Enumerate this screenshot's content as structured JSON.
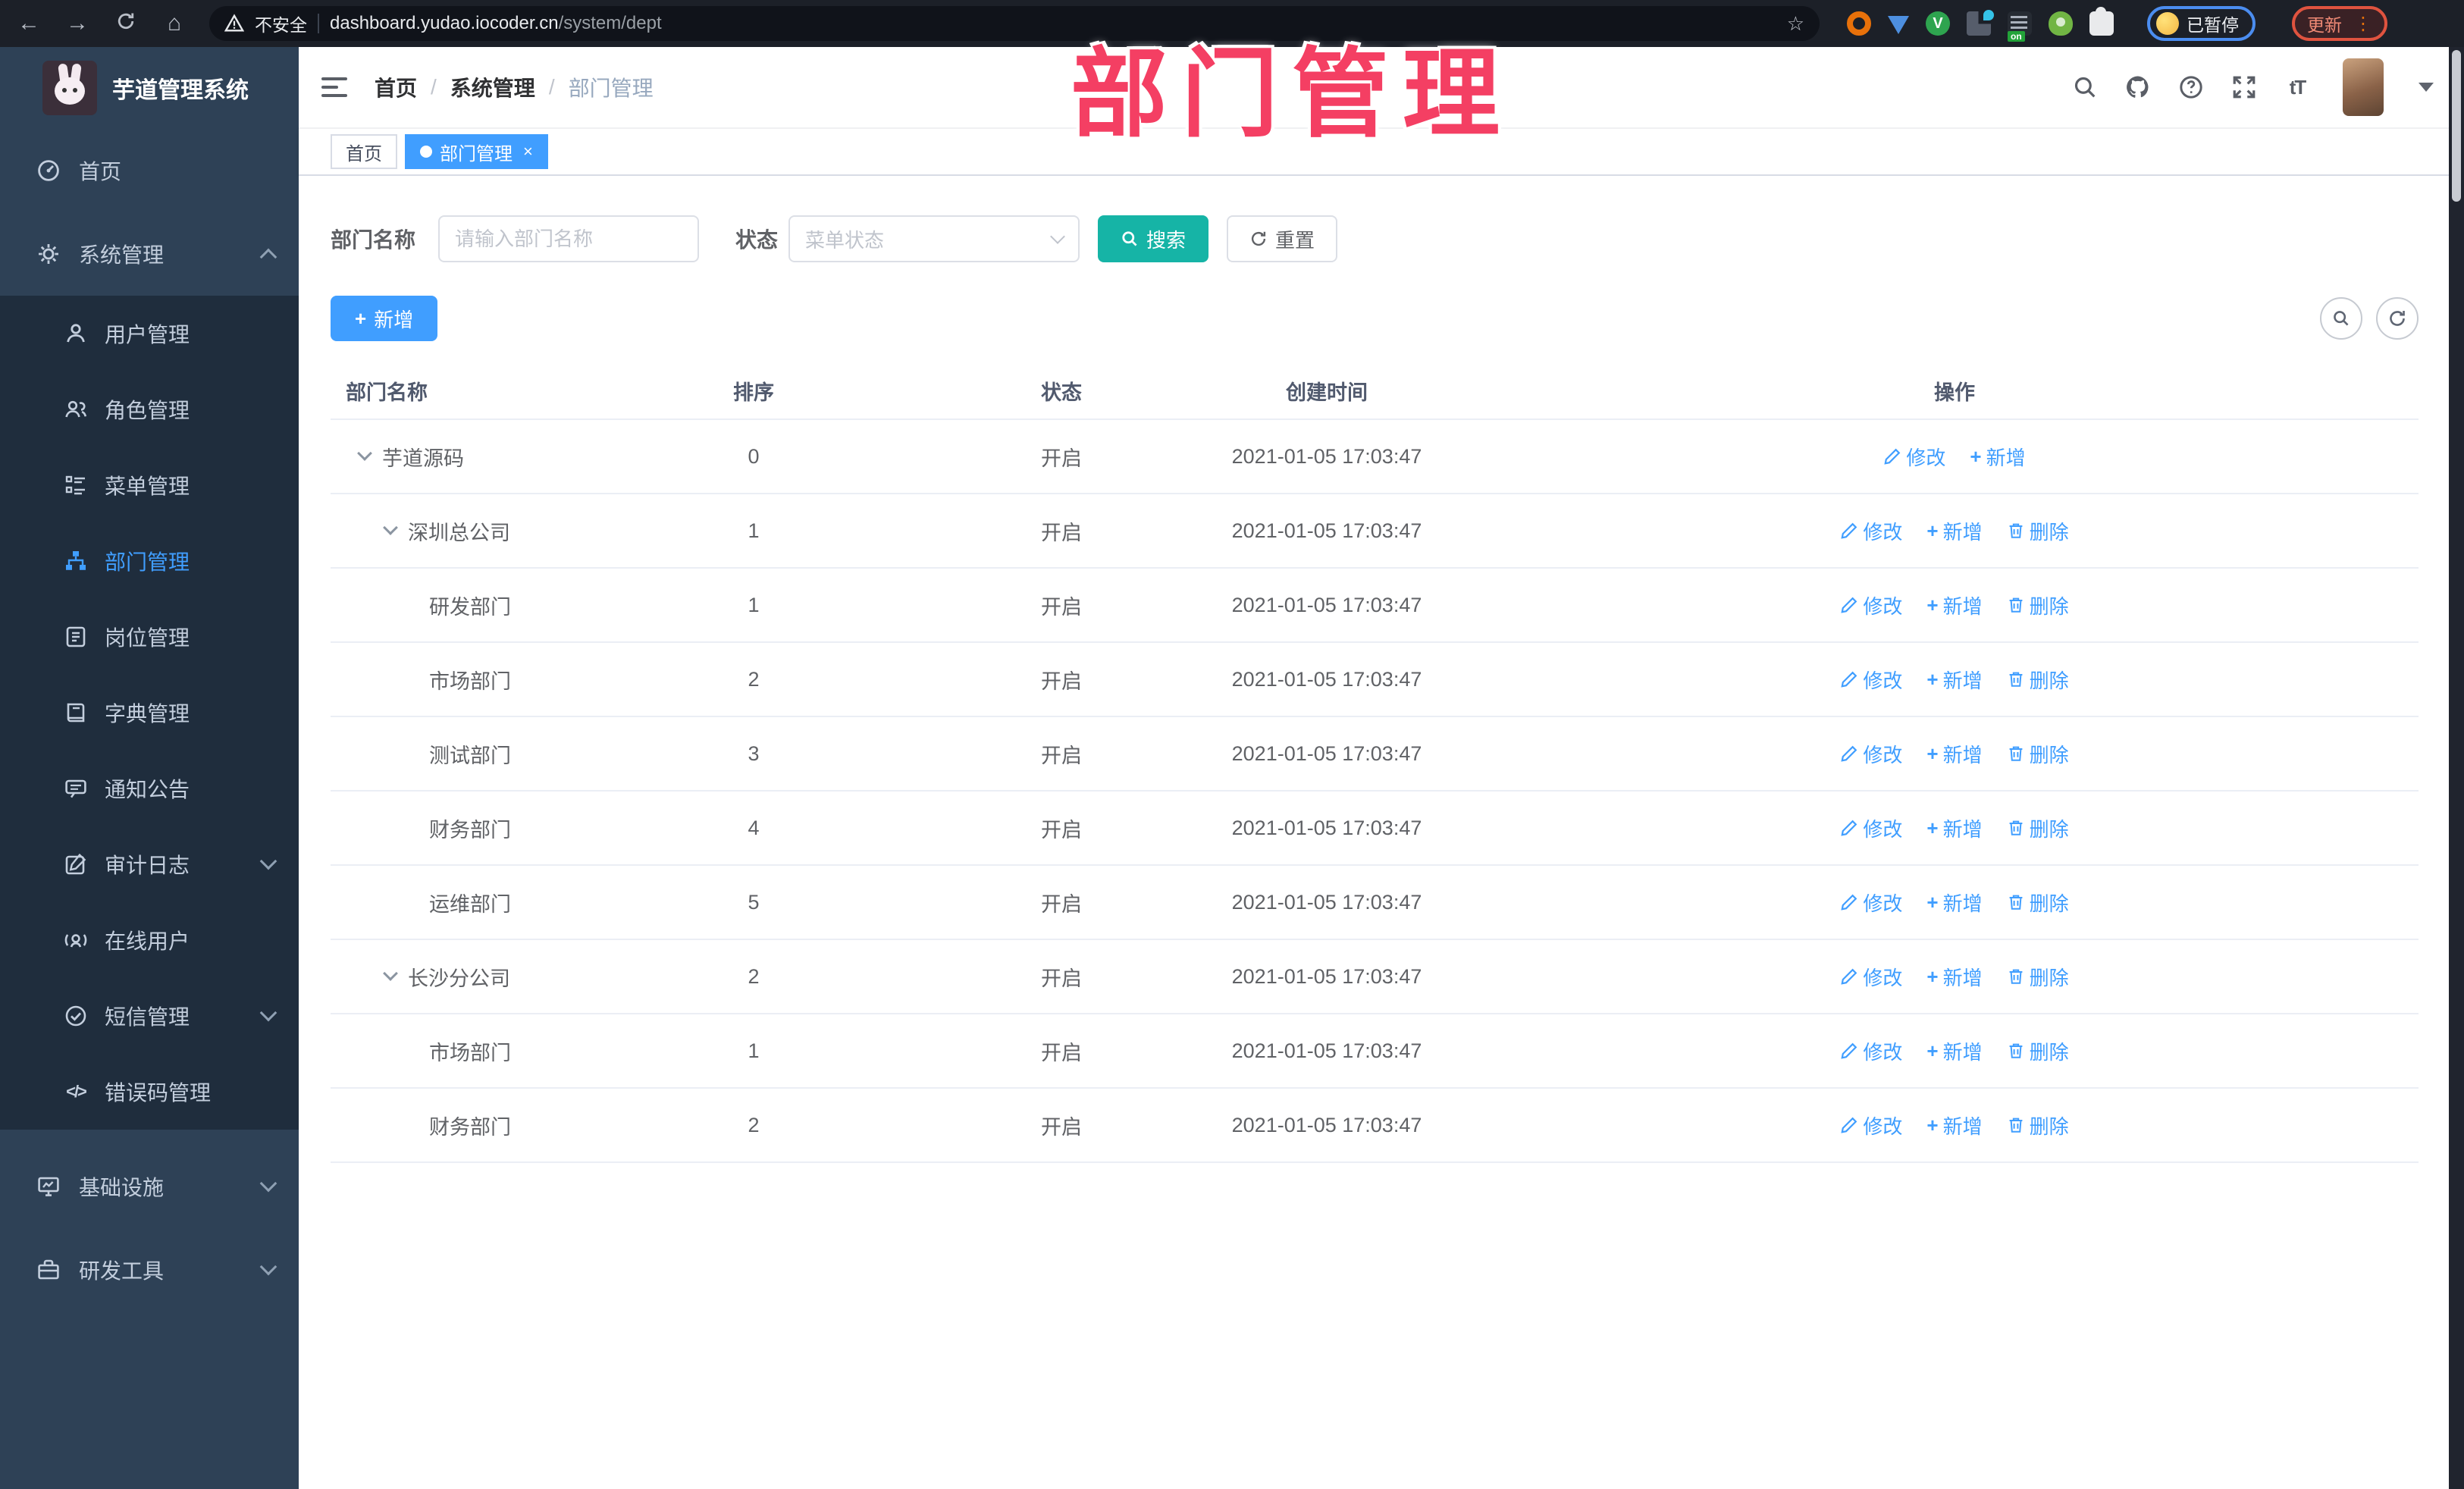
{
  "colors": {
    "accent": "#409EFF",
    "search_teal": "#16B4A6",
    "annotation_pink": "#F43F63",
    "sidebar_bg": "#2e4156",
    "submenu_bg": "#1f2d3d"
  },
  "annotation": {
    "title": "部门管理"
  },
  "browser": {
    "security_label": "不安全",
    "url_host": "dashboard.yudao.iocoder.cn",
    "url_path": "/system/dept",
    "profile_status": "已暂停",
    "update_label": "更新",
    "extension_badge": "on"
  },
  "icons": {
    "back": "←",
    "forward": "→",
    "home": "⌂",
    "star": "☆",
    "plus": "+",
    "question": "?",
    "font_size": "tT",
    "code": "</>",
    "dots": "⋮",
    "close": "×",
    "vue": "V"
  },
  "sidebar": {
    "app_title": "芋道管理系统",
    "items": [
      {
        "label": "首页"
      },
      {
        "label": "系统管理"
      },
      {
        "label": "用户管理"
      },
      {
        "label": "角色管理"
      },
      {
        "label": "菜单管理"
      },
      {
        "label": "部门管理"
      },
      {
        "label": "岗位管理"
      },
      {
        "label": "字典管理"
      },
      {
        "label": "通知公告"
      },
      {
        "label": "审计日志"
      },
      {
        "label": "在线用户"
      },
      {
        "label": "短信管理"
      },
      {
        "label": "错误码管理"
      },
      {
        "label": "基础设施"
      },
      {
        "label": "研发工具"
      }
    ]
  },
  "header": {
    "breadcrumb": [
      "首页",
      "系统管理",
      "部门管理"
    ],
    "separator": "/"
  },
  "tabs": [
    {
      "label": "首页"
    },
    {
      "label": "部门管理"
    }
  ],
  "filters": {
    "name_label": "部门名称",
    "name_placeholder": "请输入部门名称",
    "status_label": "状态",
    "status_placeholder": "菜单状态",
    "search_label": "搜索",
    "reset_label": "重置"
  },
  "toolbar": {
    "add_label": "新增"
  },
  "table": {
    "columns": [
      "部门名称",
      "排序",
      "状态",
      "创建时间",
      "操作"
    ],
    "action_labels": {
      "edit": "修改",
      "add": "新增",
      "delete": "删除"
    },
    "rows": [
      {
        "name": "芋道源码",
        "indent": 0,
        "expandable": true,
        "sort": "0",
        "status": "开启",
        "time": "2021-01-05 17:03:47"
      },
      {
        "name": "深圳总公司",
        "indent": 1,
        "expandable": true,
        "sort": "1",
        "status": "开启",
        "time": "2021-01-05 17:03:47"
      },
      {
        "name": "研发部门",
        "indent": 2,
        "expandable": false,
        "sort": "1",
        "status": "开启",
        "time": "2021-01-05 17:03:47"
      },
      {
        "name": "市场部门",
        "indent": 2,
        "expandable": false,
        "sort": "2",
        "status": "开启",
        "time": "2021-01-05 17:03:47"
      },
      {
        "name": "测试部门",
        "indent": 2,
        "expandable": false,
        "sort": "3",
        "status": "开启",
        "time": "2021-01-05 17:03:47"
      },
      {
        "name": "财务部门",
        "indent": 2,
        "expandable": false,
        "sort": "4",
        "status": "开启",
        "time": "2021-01-05 17:03:47"
      },
      {
        "name": "运维部门",
        "indent": 2,
        "expandable": false,
        "sort": "5",
        "status": "开启",
        "time": "2021-01-05 17:03:47"
      },
      {
        "name": "长沙分公司",
        "indent": 1,
        "expandable": true,
        "sort": "2",
        "status": "开启",
        "time": "2021-01-05 17:03:47"
      },
      {
        "name": "市场部门",
        "indent": 2,
        "expandable": false,
        "sort": "1",
        "status": "开启",
        "time": "2021-01-05 17:03:47"
      },
      {
        "name": "财务部门",
        "indent": 2,
        "expandable": false,
        "sort": "2",
        "status": "开启",
        "time": "2021-01-05 17:03:47"
      }
    ]
  }
}
